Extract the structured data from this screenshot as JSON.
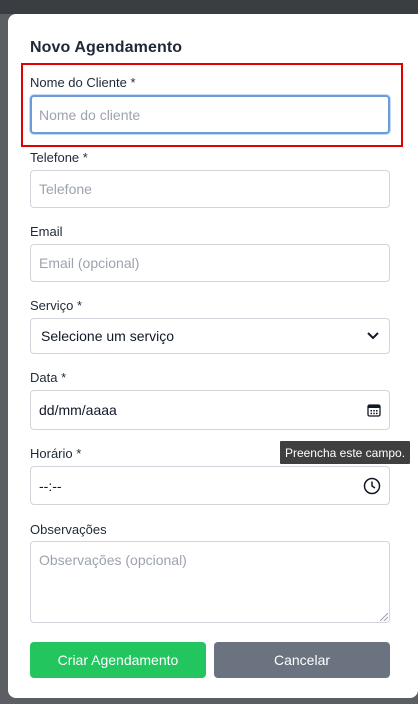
{
  "modal": {
    "title": "Novo Agendamento"
  },
  "form": {
    "cliente": {
      "label": "Nome do Cliente *",
      "placeholder": "Nome do cliente",
      "value": ""
    },
    "telefone": {
      "label": "Telefone *",
      "placeholder": "Telefone",
      "value": ""
    },
    "email": {
      "label": "Email",
      "placeholder": "Email (opcional)",
      "value": ""
    },
    "servico": {
      "label": "Serviço *",
      "selected": "Selecione um serviço"
    },
    "data": {
      "label": "Data *",
      "value": "dd/mm/aaaa",
      "icon": "calendar-icon"
    },
    "horario": {
      "label": "Horário *",
      "value": "--:--",
      "icon": "clock-icon"
    },
    "observacoes": {
      "label": "Observações",
      "placeholder": "Observações (opcional)",
      "value": ""
    }
  },
  "tooltip": {
    "text": "Preencha este campo."
  },
  "actions": {
    "submit_label": "Criar Agendamento",
    "cancel_label": "Cancelar"
  },
  "colors": {
    "primary": "#22c55e",
    "secondary": "#6b7280",
    "focus": "#6b9bd8",
    "highlight": "#e00000"
  }
}
